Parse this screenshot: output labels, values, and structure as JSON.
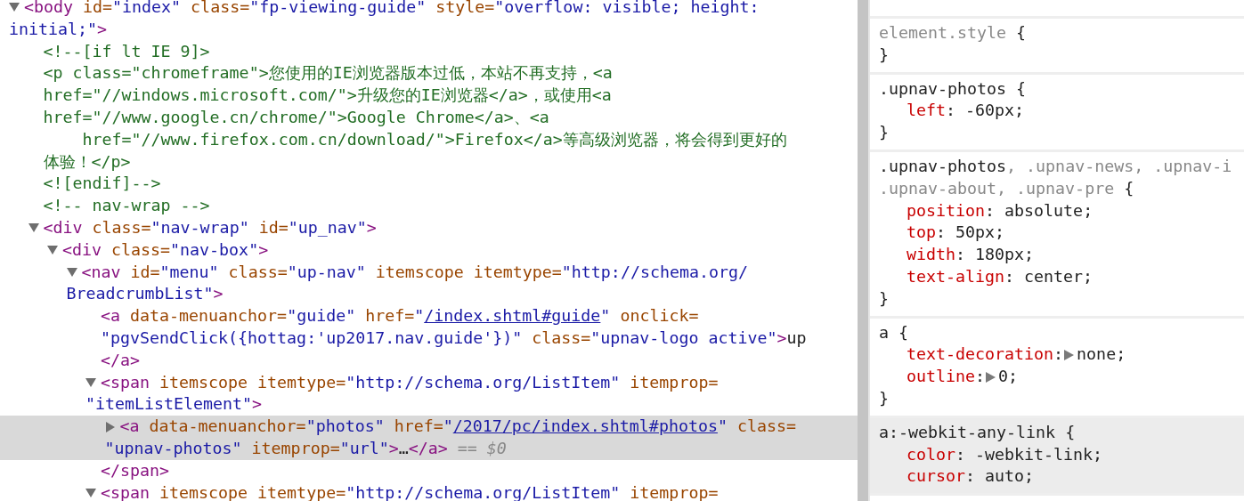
{
  "elements_panel": {
    "dom_tree": [
      {
        "kind": "container",
        "expanded": true,
        "selected": false,
        "lines": [
          [
            {
              "kind": "tag",
              "text": "<body"
            },
            {
              "kind": "attr",
              "text": " id="
            },
            {
              "kind": "value",
              "text": "\"index\""
            },
            {
              "kind": "attr",
              "text": " class="
            },
            {
              "kind": "value",
              "text": "\"fp-viewing-guide\""
            },
            {
              "kind": "attr",
              "text": " style="
            },
            {
              "kind": "value",
              "text": "\"overflow: visible; height:"
            }
          ],
          [
            {
              "kind": "value",
              "text": "initial;\""
            },
            {
              "kind": "tag",
              "text": ">"
            }
          ]
        ],
        "children": [
          {
            "kind": "leaf",
            "selected": false,
            "lines": [
              [
                {
                  "kind": "comment",
                  "text": "<!--[if lt IE 9]>"
                }
              ],
              [
                {
                  "kind": "comment",
                  "text": "<p class=\"chromeframe\">您使用的IE浏览器版本过低，本站不再支持，<a"
                }
              ],
              [
                {
                  "kind": "comment",
                  "text": "href=\"//windows.microsoft.com/\">升级您的IE浏览器</a>，或使用<a"
                }
              ],
              [
                {
                  "kind": "comment",
                  "text": "href=\"//www.google.cn/chrome/\">Google Chrome</a>、<a"
                }
              ],
              [
                {
                  "kind": "comment",
                  "text": "    href=\"//www.firefox.com.cn/download/\">Firefox</a>等高级浏览器，将会得到更好的"
                }
              ],
              [
                {
                  "kind": "comment",
                  "text": "体验！</p>"
                }
              ],
              [
                {
                  "kind": "comment",
                  "text": "<![endif]-->"
                }
              ]
            ]
          },
          {
            "kind": "leaf",
            "selected": false,
            "lines": [
              [
                {
                  "kind": "comment",
                  "text": "<!-- nav-wrap -->"
                }
              ]
            ]
          },
          {
            "kind": "container",
            "expanded": true,
            "selected": false,
            "lines": [
              [
                {
                  "kind": "tag",
                  "text": "<div"
                },
                {
                  "kind": "attr",
                  "text": " class="
                },
                {
                  "kind": "value",
                  "text": "\"nav-wrap\""
                },
                {
                  "kind": "attr",
                  "text": " id="
                },
                {
                  "kind": "value",
                  "text": "\"up_nav\""
                },
                {
                  "kind": "tag",
                  "text": ">"
                }
              ]
            ],
            "children": [
              {
                "kind": "container",
                "expanded": true,
                "selected": false,
                "lines": [
                  [
                    {
                      "kind": "tag",
                      "text": "<div"
                    },
                    {
                      "kind": "attr",
                      "text": " class="
                    },
                    {
                      "kind": "value",
                      "text": "\"nav-box\""
                    },
                    {
                      "kind": "tag",
                      "text": ">"
                    }
                  ]
                ],
                "children": [
                  {
                    "kind": "container",
                    "expanded": true,
                    "selected": false,
                    "lines": [
                      [
                        {
                          "kind": "tag",
                          "text": "<nav"
                        },
                        {
                          "kind": "attr",
                          "text": " id="
                        },
                        {
                          "kind": "value",
                          "text": "\"menu\""
                        },
                        {
                          "kind": "attr",
                          "text": " class="
                        },
                        {
                          "kind": "value",
                          "text": "\"up-nav\""
                        },
                        {
                          "kind": "attr",
                          "text": " itemscope itemtype="
                        },
                        {
                          "kind": "value",
                          "text": "\"http://schema.org/"
                        }
                      ],
                      [
                        {
                          "kind": "value",
                          "text": "BreadcrumbList\""
                        },
                        {
                          "kind": "tag",
                          "text": ">"
                        }
                      ]
                    ],
                    "children": [
                      {
                        "kind": "leaf",
                        "selected": false,
                        "lines": [
                          [
                            {
                              "kind": "tag",
                              "text": "<a"
                            },
                            {
                              "kind": "attr",
                              "text": " data-menuanchor="
                            },
                            {
                              "kind": "value",
                              "text": "\"guide\""
                            },
                            {
                              "kind": "attr",
                              "text": " href="
                            },
                            {
                              "kind": "value",
                              "text": "\""
                            },
                            {
                              "kind": "link",
                              "text": "/index.shtml#guide"
                            },
                            {
                              "kind": "value",
                              "text": "\""
                            },
                            {
                              "kind": "attr",
                              "text": " onclick="
                            }
                          ],
                          [
                            {
                              "kind": "value",
                              "text": "\"pgvSendClick({hottag:'up2017.nav.guide'})\""
                            },
                            {
                              "kind": "attr",
                              "text": " class="
                            },
                            {
                              "kind": "value",
                              "text": "\"upnav-logo active\""
                            },
                            {
                              "kind": "tag",
                              "text": ">"
                            },
                            {
                              "kind": "text",
                              "text": "up"
                            }
                          ],
                          [
                            {
                              "kind": "tag",
                              "text": "</a>"
                            }
                          ]
                        ]
                      },
                      {
                        "kind": "container",
                        "expanded": true,
                        "selected": false,
                        "lines": [
                          [
                            {
                              "kind": "tag",
                              "text": "<span"
                            },
                            {
                              "kind": "attr",
                              "text": " itemscope itemtype="
                            },
                            {
                              "kind": "value",
                              "text": "\"http://schema.org/ListItem\""
                            },
                            {
                              "kind": "attr",
                              "text": " itemprop="
                            }
                          ],
                          [
                            {
                              "kind": "value",
                              "text": "\"itemListElement\""
                            },
                            {
                              "kind": "tag",
                              "text": ">"
                            }
                          ]
                        ],
                        "children": [
                          {
                            "kind": "container",
                            "expanded": false,
                            "selected": true,
                            "lines": [
                              [
                                {
                                  "kind": "tag",
                                  "text": "<a"
                                },
                                {
                                  "kind": "attr",
                                  "text": " data-menuanchor="
                                },
                                {
                                  "kind": "value",
                                  "text": "\"photos\""
                                },
                                {
                                  "kind": "attr",
                                  "text": " href="
                                },
                                {
                                  "kind": "value",
                                  "text": "\""
                                },
                                {
                                  "kind": "link",
                                  "text": "/2017/pc/index.shtml#photos"
                                },
                                {
                                  "kind": "value",
                                  "text": "\""
                                },
                                {
                                  "kind": "attr",
                                  "text": " class="
                                }
                              ],
                              [
                                {
                                  "kind": "value",
                                  "text": "\"upnav-photos\""
                                },
                                {
                                  "kind": "attr",
                                  "text": " itemprop="
                                },
                                {
                                  "kind": "value",
                                  "text": "\"url\""
                                },
                                {
                                  "kind": "tag",
                                  "text": ">"
                                },
                                {
                                  "kind": "text",
                                  "text": "…"
                                },
                                {
                                  "kind": "tag",
                                  "text": "</a>"
                                },
                                {
                                  "kind": "hint",
                                  "text": " == $0"
                                }
                              ]
                            ]
                          }
                        ],
                        "closing": [
                          {
                            "kind": "tag",
                            "text": "</span>"
                          }
                        ]
                      },
                      {
                        "kind": "container",
                        "expanded": true,
                        "selected": false,
                        "lines": [
                          [
                            {
                              "kind": "tag",
                              "text": "<span"
                            },
                            {
                              "kind": "attr",
                              "text": " itemscope itemtype="
                            },
                            {
                              "kind": "value",
                              "text": "\"http://schema.org/ListItem\""
                            },
                            {
                              "kind": "attr",
                              "text": " itemprop="
                            }
                          ]
                        ]
                      }
                    ]
                  }
                ]
              }
            ]
          }
        ]
      }
    ]
  },
  "styles_pane": {
    "rules": [
      {
        "user_agent": false,
        "selector_lines": [
          [
            {
              "kind": "unmatched",
              "text": "element.style"
            },
            {
              "kind": "brace",
              "text": " {"
            }
          ]
        ],
        "closing": "}"
      },
      {
        "user_agent": false,
        "selector_lines": [
          [
            {
              "kind": "matched",
              "text": ".upnav-photos"
            },
            {
              "kind": "brace",
              "text": " {"
            }
          ]
        ],
        "properties": [
          {
            "name": "left",
            "colon": ":",
            "value": "-60px;",
            "expandable": false
          }
        ],
        "closing": "}"
      },
      {
        "user_agent": false,
        "selector_lines": [
          [
            {
              "kind": "matched",
              "text": ".upnav-photos"
            },
            {
              "kind": "unmatched",
              "text": ", .upnav-news, .upnav-i"
            }
          ],
          [
            {
              "kind": "unmatched",
              "text": ".upnav-about, .upnav-pre"
            },
            {
              "kind": "brace",
              "text": " {"
            }
          ]
        ],
        "properties": [
          {
            "name": "position",
            "colon": ":",
            "value": "absolute;",
            "expandable": false
          },
          {
            "name": "top",
            "colon": ":",
            "value": "50px;",
            "expandable": false
          },
          {
            "name": "width",
            "colon": ":",
            "value": "180px;",
            "expandable": false
          },
          {
            "name": "text-align",
            "colon": ":",
            "value": "center;",
            "expandable": false
          }
        ],
        "closing": "}"
      },
      {
        "user_agent": false,
        "selector_lines": [
          [
            {
              "kind": "matched",
              "text": "a"
            },
            {
              "kind": "brace",
              "text": " {"
            }
          ]
        ],
        "properties": [
          {
            "name": "text-decoration",
            "colon": ":",
            "value": "none;",
            "expandable": true
          },
          {
            "name": "outline",
            "colon": ":",
            "value": "0;",
            "expandable": true
          }
        ],
        "closing": "}"
      },
      {
        "user_agent": true,
        "selector_lines": [
          [
            {
              "kind": "matched",
              "text": "a:-webkit-any-link"
            },
            {
              "kind": "brace",
              "text": " {"
            }
          ]
        ],
        "properties": [
          {
            "name": "color",
            "colon": ":",
            "value": "-webkit-link;",
            "expandable": false
          },
          {
            "name": "cursor",
            "colon": ":",
            "value": "auto;",
            "expandable": false
          }
        ]
      }
    ]
  }
}
